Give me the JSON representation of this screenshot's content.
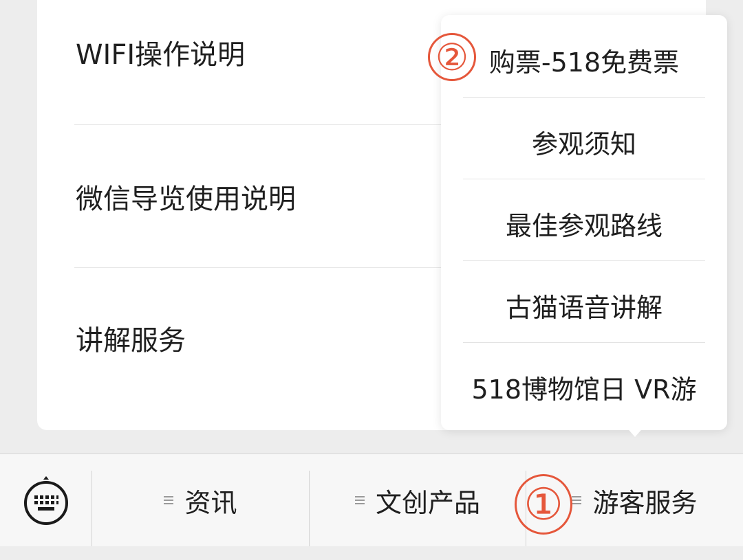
{
  "list": {
    "items": [
      {
        "label": "WIFI操作说明"
      },
      {
        "label": "微信导览使用说明"
      },
      {
        "label": "讲解服务"
      }
    ]
  },
  "popup_menu": {
    "items": [
      {
        "label": "购票-518免费票"
      },
      {
        "label": "参观须知"
      },
      {
        "label": "最佳参观路线"
      },
      {
        "label": "古猫语音讲解"
      },
      {
        "label": "518博物馆日 VR游"
      }
    ]
  },
  "bottom_bar": {
    "keyboard_icon": "keyboard-icon",
    "tabs": [
      {
        "label": "资讯",
        "icon": "menu-lines-icon"
      },
      {
        "label": "文创产品",
        "icon": "menu-lines-icon"
      },
      {
        "label": "游客服务",
        "icon": "menu-lines-icon"
      }
    ]
  },
  "annotations": {
    "step1": "①",
    "step2": "②",
    "color": "#e5573b"
  }
}
